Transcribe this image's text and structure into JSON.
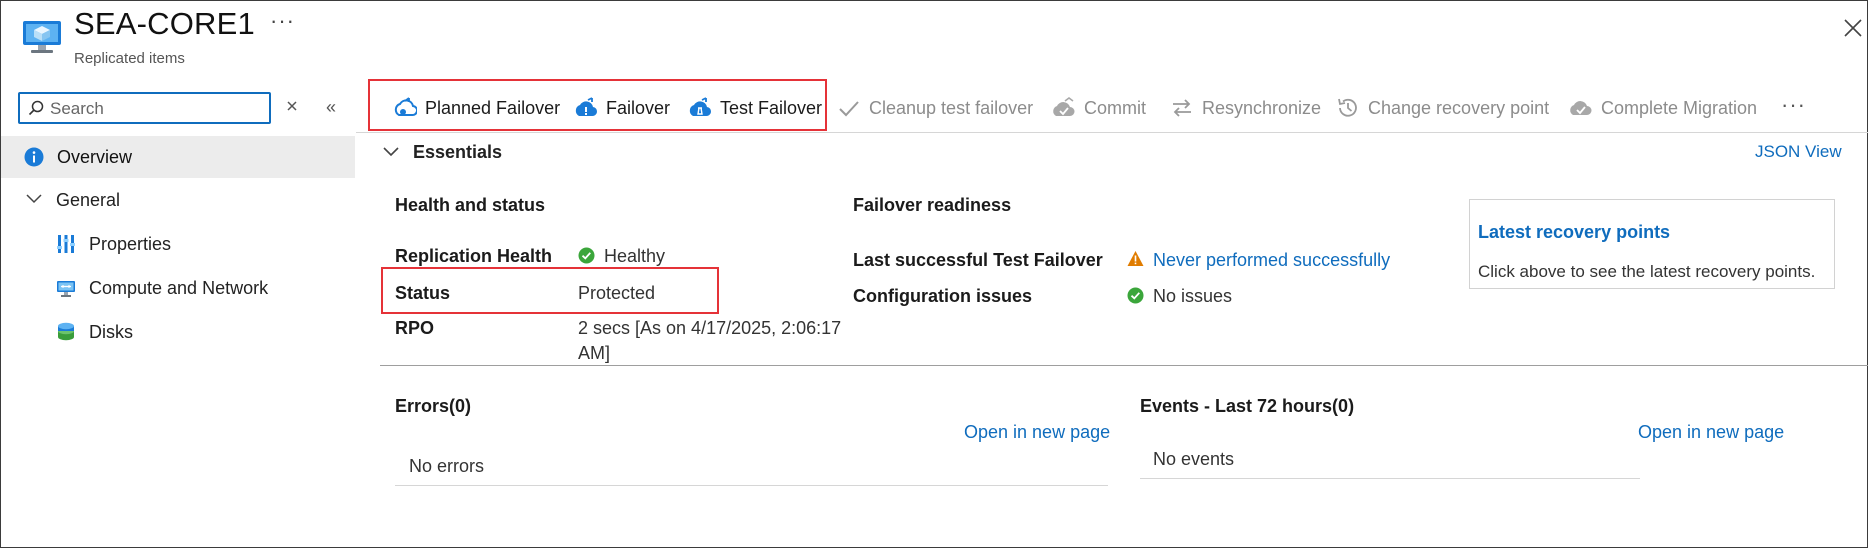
{
  "header": {
    "title": "SEA-CORE1",
    "more": "···",
    "subtitle": "Replicated items"
  },
  "sidebar": {
    "search_placeholder": "Search",
    "collapse_glyph": "«",
    "overview_label": "Overview",
    "general_label": "General",
    "items": [
      {
        "label": "Properties",
        "icon": "properties-icon"
      },
      {
        "label": "Compute and Network",
        "icon": "compute-network-icon"
      },
      {
        "label": "Disks",
        "icon": "disks-icon"
      }
    ]
  },
  "toolbar": {
    "planned_failover": "Planned Failover",
    "failover": "Failover",
    "test_failover": "Test Failover",
    "cleanup_test_failover": "Cleanup test failover",
    "commit": "Commit",
    "resynchronize": "Resynchronize",
    "change_recovery_point": "Change recovery point",
    "complete_migration": "Complete Migration",
    "more": "···"
  },
  "essentials": {
    "title": "Essentials",
    "json_view": "JSON View",
    "health": {
      "heading": "Health and status",
      "replication_health_label": "Replication Health",
      "replication_health_value": "Healthy",
      "status_label": "Status",
      "status_value": "Protected",
      "rpo_label": "RPO",
      "rpo_value_line1": "2 secs [As on 4/17/2025, 2:06:17",
      "rpo_value_line2": "AM]"
    },
    "failover_readiness": {
      "heading": "Failover readiness",
      "last_test_label": "Last successful Test Failover",
      "last_test_value": "Never performed successfully",
      "config_label": "Configuration issues",
      "config_value": "No issues"
    },
    "recovery_points": {
      "title": "Latest recovery points",
      "description": "Click above to see the latest recovery points."
    }
  },
  "errors": {
    "heading": "Errors(0)",
    "open_link": "Open in new page",
    "empty": "No errors"
  },
  "events": {
    "heading": "Events - Last 72 hours(0)",
    "open_link": "Open in new page",
    "empty": "No events"
  },
  "colors": {
    "accent": "#0f6cbd",
    "highlight_box": "#e53238",
    "success": "#3ba63b",
    "warning": "#e07c00",
    "disabled_text": "#8c8c8c"
  }
}
